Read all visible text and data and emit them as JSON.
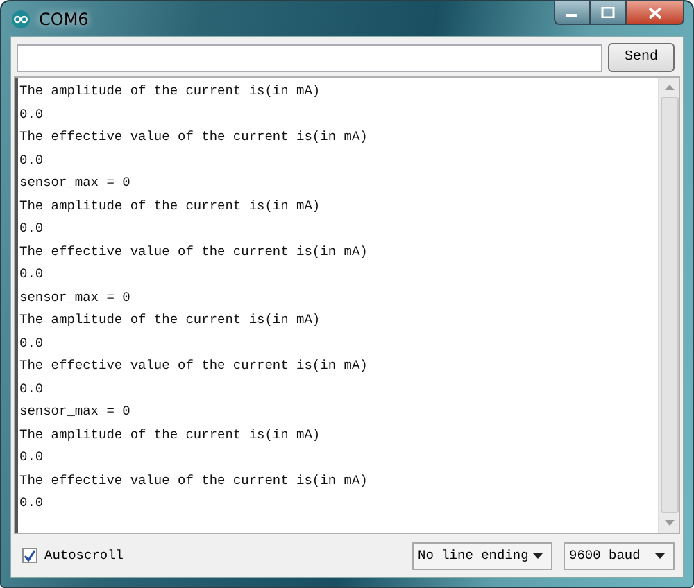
{
  "window": {
    "title": "COM6"
  },
  "send_button": "Send",
  "output_lines": [
    "The amplitude of the current is(in mA)",
    "0.0",
    "The effective value of the current is(in mA)",
    "0.0",
    "sensor_max = 0",
    "The amplitude of the current is(in mA)",
    "0.0",
    "The effective value of the current is(in mA)",
    "0.0",
    "sensor_max = 0",
    "The amplitude of the current is(in mA)",
    "0.0",
    "The effective value of the current is(in mA)",
    "0.0",
    "sensor_max = 0",
    "The amplitude of the current is(in mA)",
    "0.0",
    "The effective value of the current is(in mA)",
    "0.0"
  ],
  "autoscroll": {
    "label": "Autoscroll",
    "checked": true
  },
  "line_ending": "No line ending",
  "baud": "9600 baud"
}
